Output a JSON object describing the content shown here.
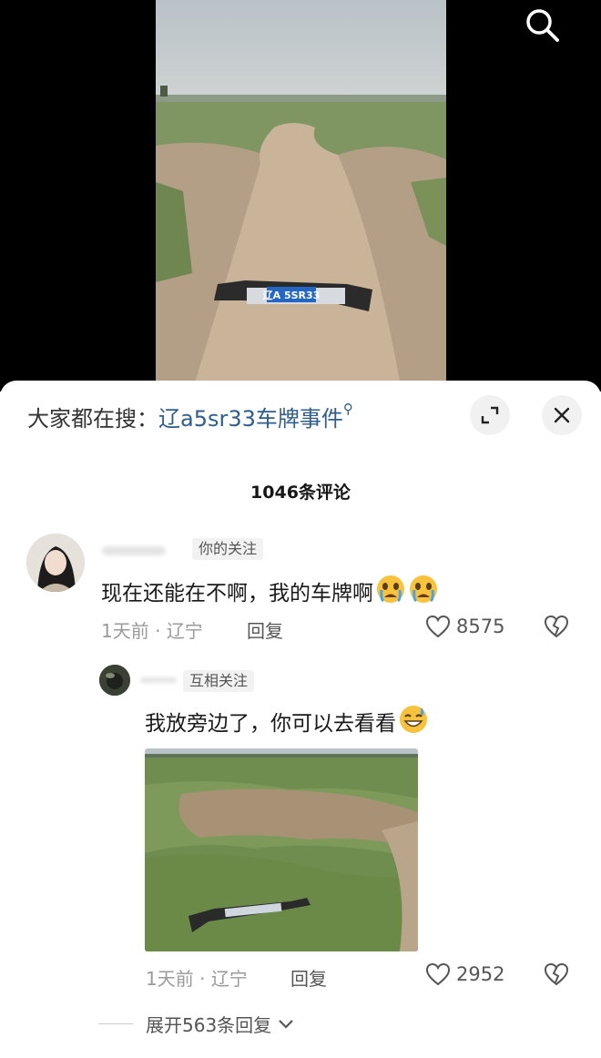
{
  "video": {
    "plate_text": "辽A 5SR33",
    "search_icon": "search-icon"
  },
  "sheet": {
    "suggest_prefix": "大家都在搜：",
    "suggest_query": "辽a5sr33车牌事件",
    "suggest_icon": "search-icon-small",
    "expand_icon": "expand-icon",
    "close_icon": "close-icon",
    "comment_count": "1046条评论"
  },
  "comments": [
    {
      "tag": "你的关注",
      "text": "现在还能在不啊，我的车牌啊",
      "emoji": [
        "crying-emoji",
        "crying-emoji"
      ],
      "time": "1天前",
      "location": "辽宁",
      "reply_label": "回复",
      "likes": "8575"
    }
  ],
  "reply": {
    "tag": "互相关注",
    "text": "我放旁边了，你可以去看看",
    "emoji": [
      "sweat-smile-emoji"
    ],
    "time": "1天前",
    "location": "辽宁",
    "reply_label": "回复",
    "likes": "2952"
  },
  "expand_label": "展开563条回复",
  "colors": {
    "link": "#2f5d8c",
    "meta": "#9a9a9a",
    "text": "#1a1a1a"
  }
}
